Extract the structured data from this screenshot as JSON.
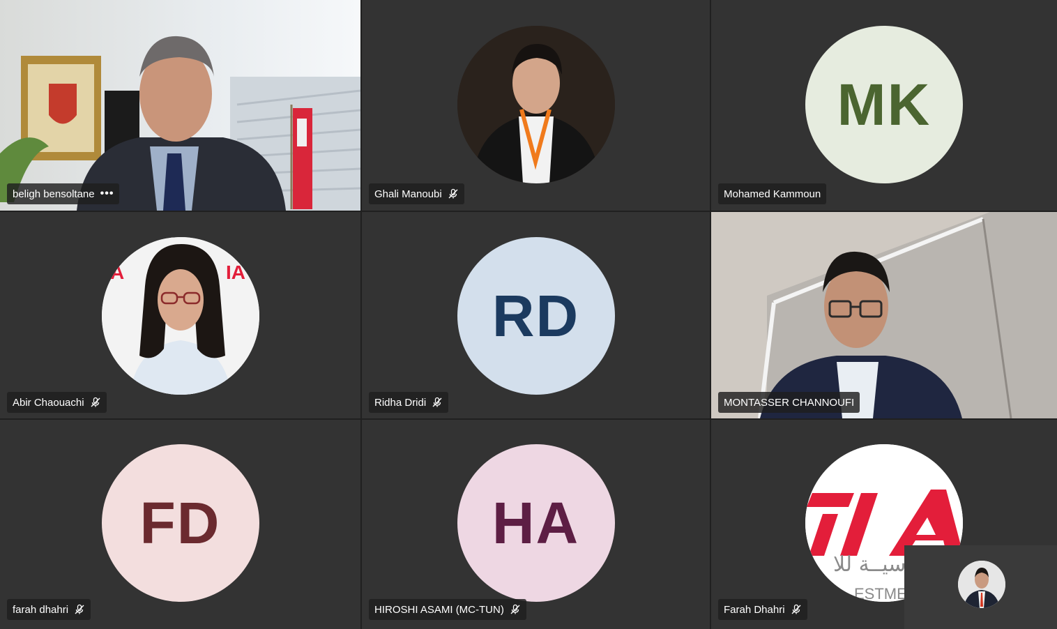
{
  "participants": [
    {
      "name": "beligh bensoltane",
      "video": true,
      "status": "more-options"
    },
    {
      "name": "Ghali Manoubi",
      "video": false,
      "photo": true,
      "muted": true
    },
    {
      "name": "Mohamed Kammoun",
      "video": false,
      "initials": "MK",
      "avatar_bg": "#e6ecdf",
      "avatar_fg": "#4b6530"
    },
    {
      "name": "Abir Chaouachi",
      "video": false,
      "photo": true,
      "muted": true
    },
    {
      "name": "Ridha Dridi",
      "video": false,
      "initials": "RD",
      "avatar_bg": "#d3dfec",
      "avatar_fg": "#1b3a5f",
      "muted": true
    },
    {
      "name": "MONTASSER CHANNOUFI",
      "video": true
    },
    {
      "name": "farah dhahri",
      "video": false,
      "initials": "FD",
      "avatar_bg": "#f3dede",
      "avatar_fg": "#6b2a2f",
      "muted": true
    },
    {
      "name": "HIROSHI ASAMI (MC-TUN)",
      "video": false,
      "initials": "HA",
      "avatar_bg": "#eed7e3",
      "avatar_fg": "#5d1e44",
      "muted": true
    },
    {
      "name": "Farah Dhahri",
      "video": false,
      "photo": true,
      "muted": true
    }
  ],
  "more_options_glyph": "•••",
  "icons": {
    "mic_off": "microphone-off-icon",
    "more": "more-options-icon"
  },
  "colors": {
    "tile_bg": "#333333",
    "gap_bg": "#202020",
    "label_bg": "rgba(30,30,30,0.82)",
    "brand_red": "#e31e3a"
  }
}
